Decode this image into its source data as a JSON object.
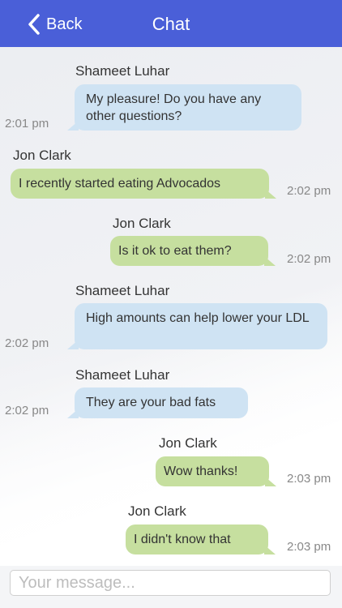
{
  "navbar": {
    "back_label": "Back",
    "title": "Chat"
  },
  "messages": [
    {
      "sender": "Shameet Luhar",
      "text": "My pleasure! Do you have any other questions?",
      "time": "2:01 pm",
      "side": "incoming"
    },
    {
      "sender": "Jon Clark",
      "text": "I recently started eating Advocados",
      "time": "2:02 pm",
      "side": "outgoing"
    },
    {
      "sender": "Jon Clark",
      "text": "Is it ok to eat them?",
      "time": "2:02 pm",
      "side": "outgoing"
    },
    {
      "sender": "Shameet Luhar",
      "text": "High amounts can help lower your LDL",
      "time": "2:02 pm",
      "side": "incoming"
    },
    {
      "sender": "Shameet Luhar",
      "text": "They are your bad fats",
      "time": "2:02 pm",
      "side": "incoming"
    },
    {
      "sender": "Jon Clark",
      "text": "Wow thanks!",
      "time": "2:03 pm",
      "side": "outgoing"
    },
    {
      "sender": "Jon Clark",
      "text": "I didn't know that",
      "time": "2:03 pm",
      "side": "outgoing"
    }
  ],
  "composer": {
    "placeholder": "Your message..."
  },
  "colors": {
    "navbar": "#4a5fd8",
    "incoming_bubble": "#cfe3f3",
    "outgoing_bubble": "#c6df9f"
  }
}
